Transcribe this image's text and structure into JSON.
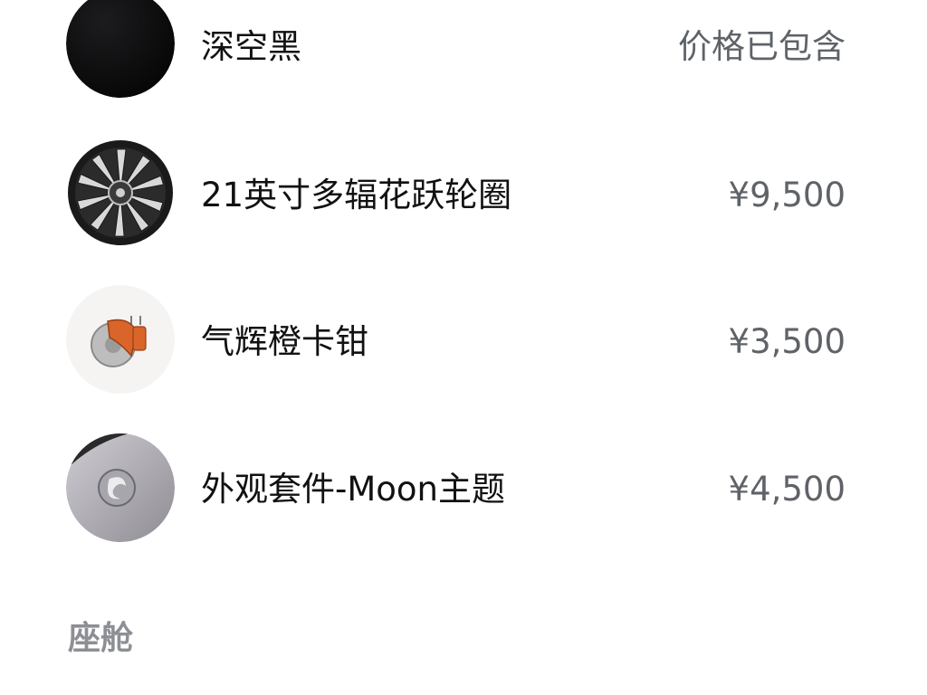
{
  "options": [
    {
      "name": "深空黑",
      "price": "价格已包含",
      "thumb_icon": "black-paint-swatch-icon",
      "thumb_color": "#0b0b0c"
    },
    {
      "name": "21英寸多辐花跃轮圈",
      "price": "¥9,500",
      "thumb_icon": "wheel-rim-icon"
    },
    {
      "name": "气辉橙卡钳",
      "price": "¥3,500",
      "thumb_icon": "brake-caliper-icon",
      "accent_color": "#d9652a"
    },
    {
      "name": "外观套件-Moon主题",
      "price": "¥4,500",
      "thumb_icon": "moon-theme-badge-icon"
    }
  ],
  "section": {
    "title": "座舱"
  }
}
